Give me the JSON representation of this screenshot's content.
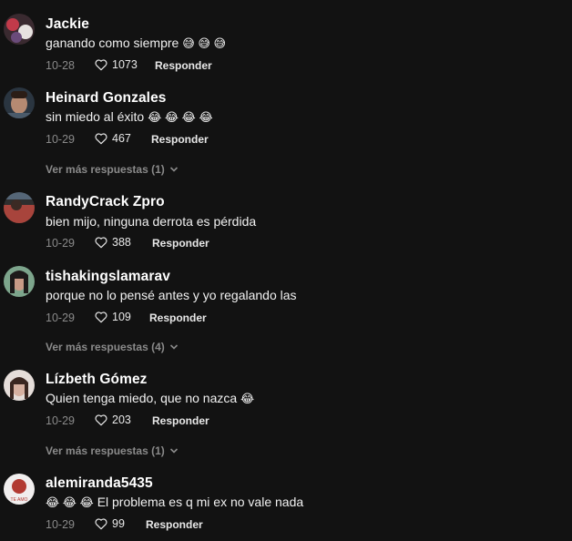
{
  "comments": [
    {
      "username": "Jackie",
      "text": "ganando como siempre",
      "emoji": "😅 😅 😅",
      "date": "10-28",
      "likes": "1073",
      "reply": "Responder",
      "avatar_color": "#c23a4a"
    },
    {
      "username": "Heinard Gonzales",
      "text": "sin miedo al éxito",
      "emoji": "😂 😂 😂 😂",
      "date": "10-29",
      "likes": "467",
      "reply": "Responder",
      "more": "Ver más respuestas (1)",
      "avatar_color": "#b58a72"
    },
    {
      "username": "RandyCrack Zpro",
      "text": "bien mijo, ninguna derrota es pérdida",
      "emoji": "",
      "date": "10-29",
      "likes": "388",
      "reply": "Responder",
      "avatar_color": "#a8443c"
    },
    {
      "username": "tishakingslamarav",
      "text": "porque no lo pensé antes y yo regalando las",
      "emoji": "",
      "date": "10-29",
      "likes": "109",
      "reply": "Responder",
      "more": "Ver más respuestas (4)",
      "avatar_color": "#7da58c"
    },
    {
      "username": "Lízbeth Gómez",
      "text": "Quien tenga miedo, que no nazca",
      "emoji": "😂",
      "date": "10-29",
      "likes": "203",
      "reply": "Responder",
      "more": "Ver más respuestas (1)",
      "avatar_color": "#d8c9c4"
    },
    {
      "username": "alemiranda5435",
      "text": "El problema es q mi ex no vale nada",
      "emoji": "😂 😂 😂",
      "date": "10-29",
      "likes": "99",
      "reply": "Responder",
      "avatar_color": "#b23a32",
      "avatar_text": "TE AMO"
    }
  ]
}
